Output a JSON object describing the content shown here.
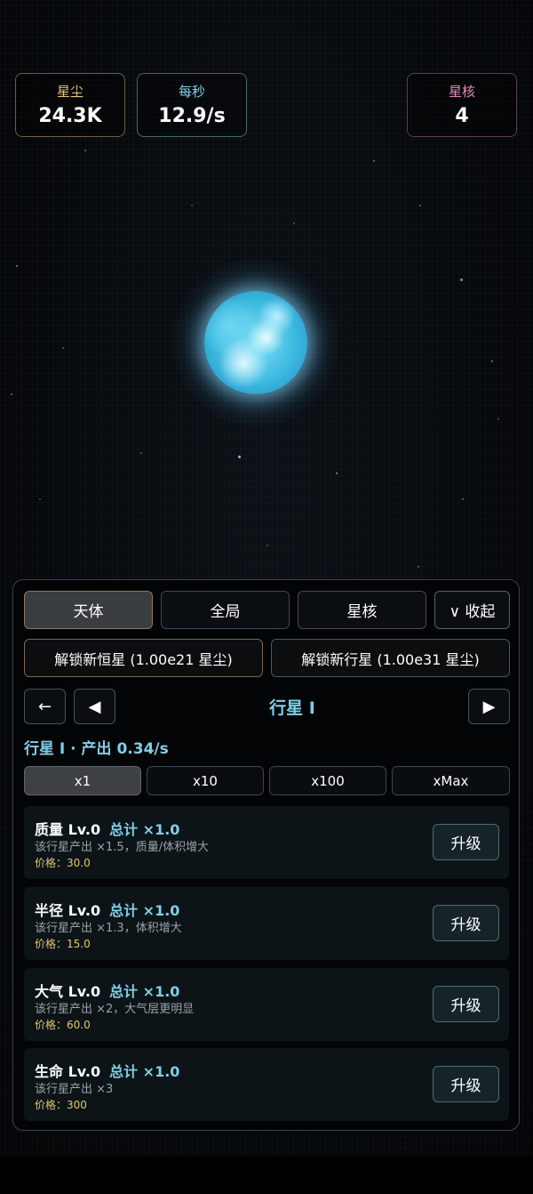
{
  "stats": {
    "stardust": {
      "label": "星尘",
      "value": "24.3K",
      "color": "#e8c66a"
    },
    "per_sec": {
      "label": "每秒",
      "value": "12.9/s",
      "color": "#7fd0ea"
    },
    "core": {
      "label": "星核",
      "value": "4",
      "color": "#e08bc0"
    }
  },
  "tabs": {
    "body": "天体",
    "global": "全局",
    "core": "星核",
    "collapse": "∨ 收起"
  },
  "unlock": {
    "star": "解锁新恒星 (1.00e21 星尘)",
    "planet": "解锁新行星 (1.00e31 星尘)"
  },
  "nav": {
    "back": "←",
    "prev": "◀",
    "title": "行星 I",
    "next": "▶"
  },
  "output_line": "行星 I · 产出 0.34/s",
  "multipliers": [
    "x1",
    "x10",
    "x100",
    "xMax"
  ],
  "upgrades": [
    {
      "name": "质量 Lv.0",
      "total": "总计 ×1.0",
      "desc": "该行星产出 ×1.5，质量/体积增大",
      "price": "价格：30.0",
      "button": "升级"
    },
    {
      "name": "半径 Lv.0",
      "total": "总计 ×1.0",
      "desc": "该行星产出 ×1.3，体积增大",
      "price": "价格：15.0",
      "button": "升级"
    },
    {
      "name": "大气 Lv.0",
      "total": "总计 ×1.0",
      "desc": "该行星产出 ×2，大气层更明显",
      "price": "价格：60.0",
      "button": "升级"
    },
    {
      "name": "生命 Lv.0",
      "total": "总计 ×1.0",
      "desc": "该行星产出 ×3",
      "price": "价格：300",
      "button": "升级"
    }
  ],
  "colors": {
    "accent": "#7fd0ea",
    "gold": "#e8c66a",
    "pink": "#e08bc0"
  }
}
